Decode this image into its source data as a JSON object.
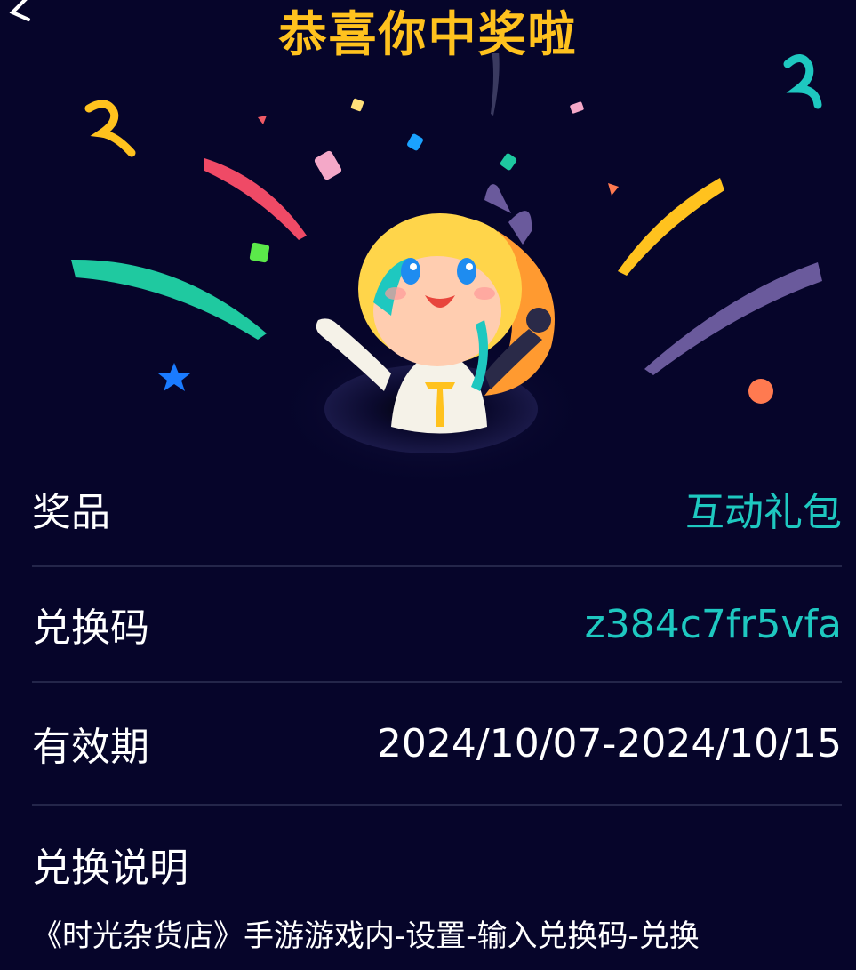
{
  "page": {
    "title": "恭喜你中奖啦"
  },
  "prize": {
    "label": "奖品",
    "value": "互动礼包"
  },
  "code": {
    "label": "兑换码",
    "value": "z384c7fr5vfa"
  },
  "validity": {
    "label": "有效期",
    "value": "2024/10/07-2024/10/15"
  },
  "instructions": {
    "title": "兑换说明",
    "text": "《时光杂货店》手游游戏内-设置-输入兑换码-兑换"
  },
  "colors": {
    "background": "#06052a",
    "title": "#ffc21e",
    "accent": "#1ec8c0",
    "divider": "#24264a"
  }
}
